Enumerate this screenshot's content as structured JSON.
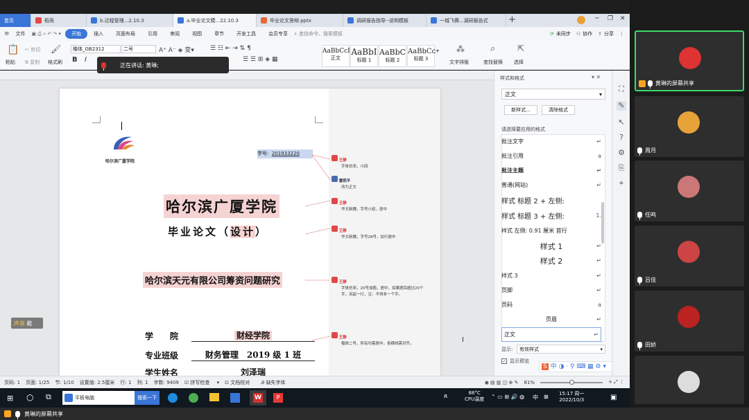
{
  "tabs": [
    {
      "label": "首页"
    },
    {
      "label": "稻壳"
    },
    {
      "label": "b.过程管理...2.10.3"
    },
    {
      "label": "a.毕业论文模...22.10.3"
    },
    {
      "label": "毕业论文答辩.pptx"
    },
    {
      "label": "调研报告指导--说明模板"
    },
    {
      "label": "一城飞赛...调研报告式"
    }
  ],
  "menu": {
    "file": "文件",
    "items": [
      "开始",
      "插入",
      "页面布局",
      "引用",
      "审阅",
      "视图",
      "章节",
      "开发工具",
      "会员专享"
    ],
    "search": "查找命令、搜索模板",
    "unsynced": "未同步",
    "collab": "协作",
    "share": "分享"
  },
  "ribbon": {
    "paste": "粘贴",
    "cut": "剪切",
    "copy": "复制",
    "format_painter": "格式刷",
    "font_name": "楷体_GB2312",
    "font_size": "二号",
    "styles": [
      {
        "sample": "AaBbCcI",
        "name": "正文"
      },
      {
        "sample": "AaBbI",
        "name": "标题 1"
      },
      {
        "sample": "AaBbC",
        "name": "标题 2"
      },
      {
        "sample": "AaBbCc",
        "name": "标题 3"
      }
    ],
    "text_layout": "文字排版",
    "find_replace": "查找替换",
    "select": "选择"
  },
  "speaking": "正在讲话: 黄琳;",
  "document": {
    "logo_text": "哈尔滨广厦学院",
    "student_id_label": "学号:",
    "student_id": "201933220",
    "school": "哈尔滨广厦学院",
    "thesis_a": "毕业论文（",
    "thesis_hl": "设计",
    "thesis_b": "）",
    "topic": "哈尔滨天元有限公司筹资问题研究",
    "college_label": "学　　院",
    "college": "财经学院",
    "class_label": "专业班级",
    "class": "财务管理　2019 级 1 班",
    "name_label": "学生姓名",
    "name": "刘泽瑞"
  },
  "comments": [
    {
      "author": "王静",
      "text": "字体仿宋，小四"
    },
    {
      "author": "雷莉平",
      "text": "改为正文"
    },
    {
      "author": "王静",
      "text": "华文新魏，字号小初，居中"
    },
    {
      "author": "王静",
      "text": "华文新魏，字号28号，加行居中"
    },
    {
      "author": "王静",
      "text": "字体仿宋，20号加粗，居中，如果题目超过20个字，另起一行，注：不得多一个字。"
    },
    {
      "author": "王静",
      "text": "楷体二号，所有均需居中，各横线需对齐。"
    }
  ],
  "stylepane": {
    "header": "样式和格式",
    "current": "正文",
    "new_style": "新样式...",
    "clear_format": "清除格式",
    "prompt": "请选择要应用的格式",
    "items": [
      {
        "label": "批注文字",
        "mark": "↵"
      },
      {
        "label": "批注引用",
        "mark": "a"
      },
      {
        "label": "批注主题",
        "mark": "↵"
      },
      {
        "label": "普通(网站)",
        "mark": "↵"
      },
      {
        "label": "样式 标题 2 + 左侧:",
        "mark": ""
      },
      {
        "label": "样式 标题 3 + 左侧:",
        "mark": "1."
      },
      {
        "label": "样式 左侧: 0.91 厘米 首行",
        "mark": ""
      },
      {
        "label": "样式 1",
        "mark": "↵"
      },
      {
        "label": "样式 2",
        "mark": "↵"
      },
      {
        "label": "样式 3",
        "mark": "↵"
      },
      {
        "label": "页脚",
        "mark": "↵"
      },
      {
        "label": "页码",
        "mark": "a"
      },
      {
        "label": "页眉",
        "mark": "↵"
      },
      {
        "label": "正文",
        "mark": "↵"
      }
    ],
    "display_label": "显示:",
    "display_value": "有效样式",
    "preview": "显示预览"
  },
  "status": {
    "page": "页码: 1",
    "pages": "页面: 1/25",
    "section": "节: 1/10",
    "setting": "设置值: 2.5厘米",
    "row": "行: 1",
    "col": "列: 1",
    "words": "字数: 9409",
    "spell": "拼写检查",
    "proof": "文档校对",
    "missing_font": "缺失字体",
    "zoom": "81%"
  },
  "taskbar": {
    "search_text": "平板电脑",
    "search_btn": "搜索一下",
    "weather_temp": "88°C",
    "weather_label": "CPU温度",
    "ime": "中",
    "time": "15:17 周一",
    "date": "2022/10/3"
  },
  "screen_share": "黄琳的屏幕共享",
  "sound_tag": "声音",
  "sound_tag_b": "能",
  "participants": [
    {
      "name": "黄琳的屏幕共享",
      "color": "#d33"
    },
    {
      "name": "周月",
      "color": "#e8a23a"
    },
    {
      "name": "任鸣",
      "color": "#c77"
    },
    {
      "name": "吕佳",
      "color": "#c44"
    },
    {
      "name": "田娇",
      "color": "#b22"
    },
    {
      "name": "",
      "color": "#ddd"
    }
  ]
}
